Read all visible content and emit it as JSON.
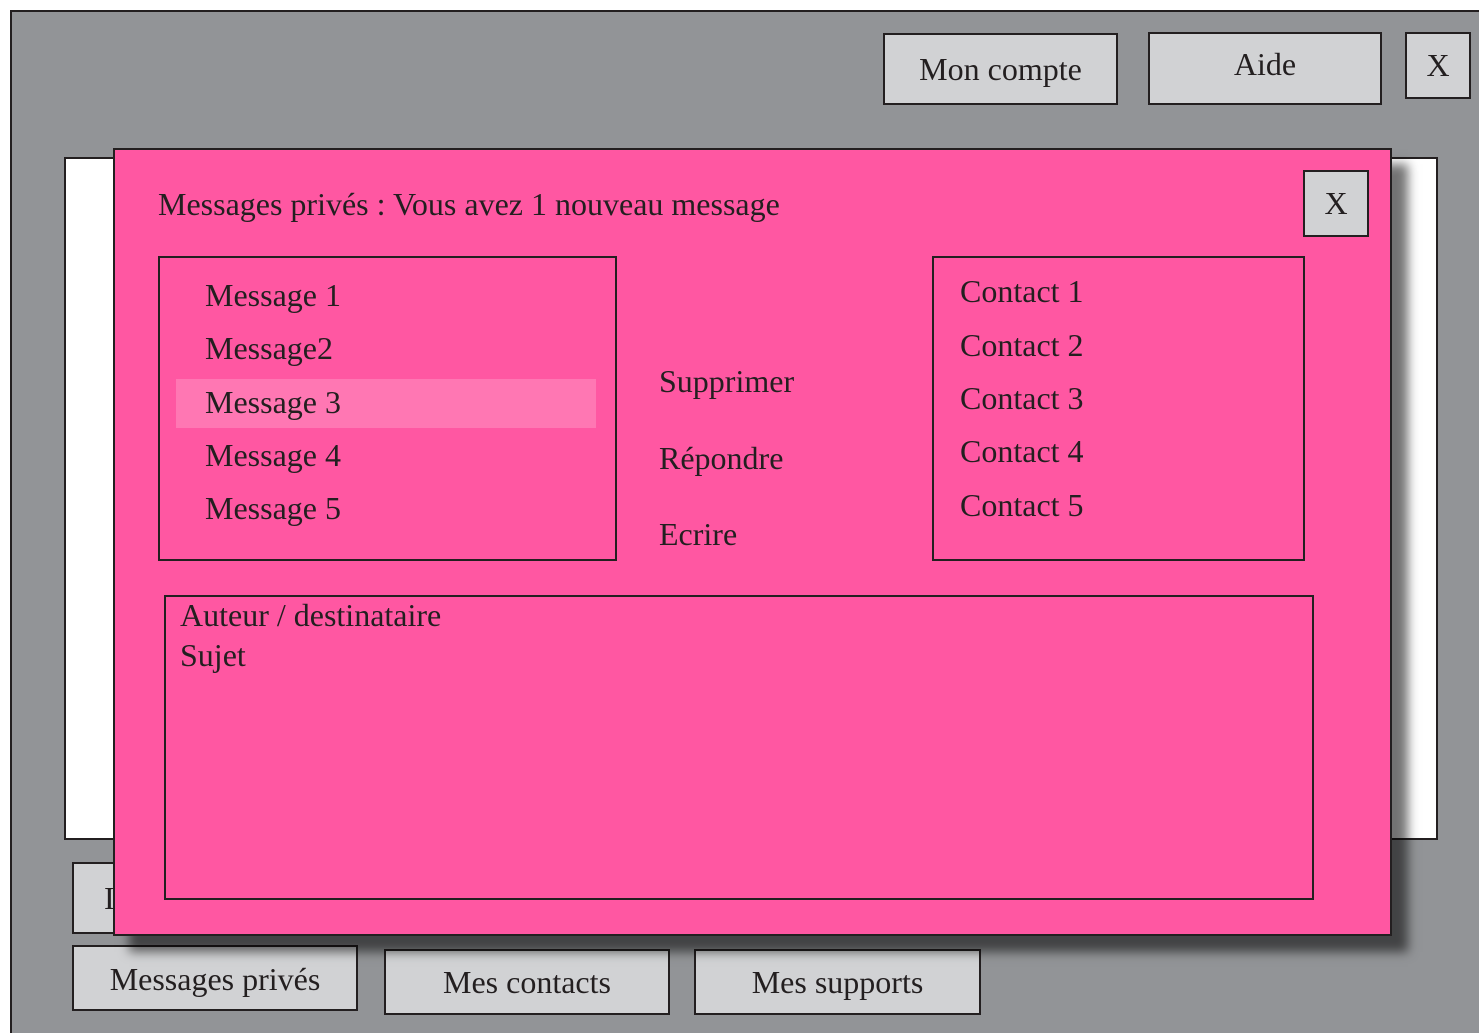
{
  "header": {
    "account_label": "Mon compte",
    "help_label": "Aide",
    "close_label": "X"
  },
  "dialog": {
    "title": "Messages privés : Vous avez 1 nouveau message",
    "close_label": "X",
    "messages": [
      "Message 1",
      "Message2",
      "Message 3",
      "Message 4",
      "Message 5"
    ],
    "selected_message_index": 2,
    "actions": {
      "delete": "Supprimer",
      "reply": "Répondre",
      "write": "Ecrire"
    },
    "contacts": [
      "Contact 1",
      "Contact 2",
      "Contact 3",
      "Contact 4",
      "Contact 5"
    ],
    "preview": {
      "author_label": "Auteur / destinataire",
      "subject_label": "Sujet"
    }
  },
  "bottom_nav": {
    "messages_label": "Messages privés",
    "contacts_label": "Mes contacts",
    "supports_label": "Mes supports"
  },
  "colors": {
    "background": "#929497",
    "dialog": "#ff57a2",
    "selection": "#ff77b3",
    "button": "#d1d2d4"
  }
}
